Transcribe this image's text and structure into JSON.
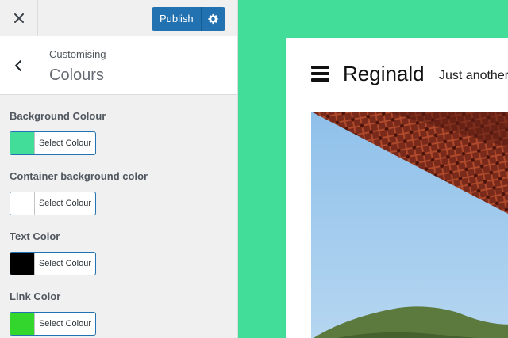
{
  "customizer": {
    "close_icon": "close-icon",
    "publish_label": "Publish",
    "settings_icon": "gear-icon",
    "back_icon": "chevron-left-icon",
    "section_subtitle": "Customising",
    "section_title": "Colours",
    "controls": [
      {
        "label": "Background Colour",
        "button": "Select Colour",
        "color": "#42dd99"
      },
      {
        "label": "Container background color",
        "button": "Select Colour",
        "color": "#ffffff"
      },
      {
        "label": "Text Color",
        "button": "Select Colour",
        "color": "#000000"
      },
      {
        "label": "Link Color",
        "button": "Select Colour",
        "color": "#33d62c"
      }
    ]
  },
  "preview": {
    "site_title": "Reginald",
    "tagline": "Just another",
    "background_color": "#42dd99",
    "menu_icon": "hamburger-menu-icon",
    "hero_image": "bridge-photo"
  }
}
